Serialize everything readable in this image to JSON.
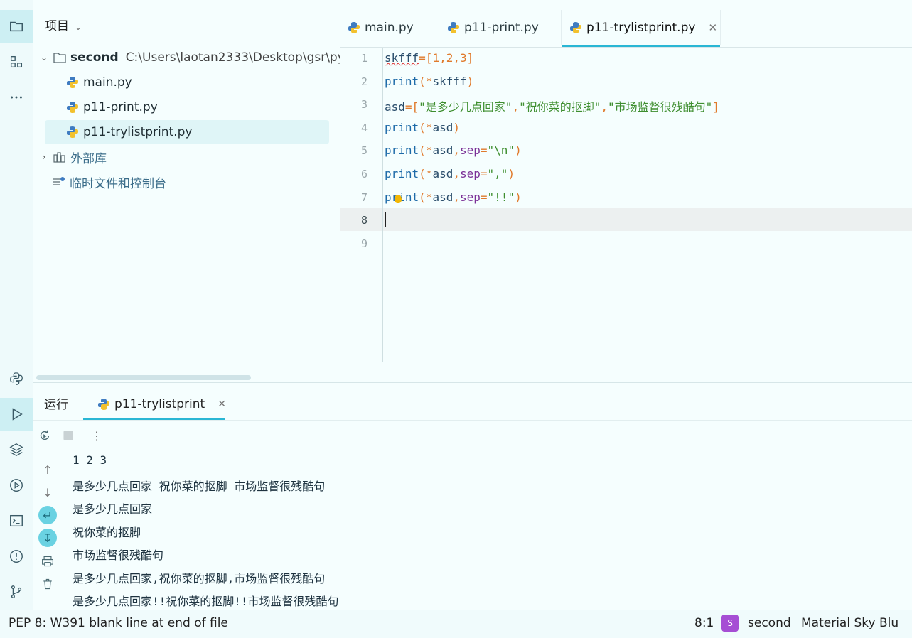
{
  "project_panel": {
    "title": "项目",
    "tree": {
      "root_name": "second",
      "root_path": "C:\\Users\\laotan2333\\Desktop\\gsr\\py",
      "files": [
        "main.py",
        "p11-print.py",
        "p11-trylistprint.py"
      ],
      "external_libs": "外部库",
      "scratches": "临时文件和控制台"
    }
  },
  "tabs": [
    {
      "label": "main.py"
    },
    {
      "label": "p11-print.py"
    },
    {
      "label": "p11-trylistprint.py"
    }
  ],
  "editor": {
    "line_numbers": [
      "1",
      "2",
      "3",
      "4",
      "5",
      "6",
      "7",
      "8",
      "9"
    ],
    "current_line": "8",
    "lines": [
      [
        {
          "t": "skfff",
          "c": "var wavy"
        },
        {
          "t": "=[",
          "c": "op"
        },
        {
          "t": "1",
          "c": "num"
        },
        {
          "t": ",",
          "c": "op"
        },
        {
          "t": "2",
          "c": "num"
        },
        {
          "t": ",",
          "c": "op"
        },
        {
          "t": "3",
          "c": "num"
        },
        {
          "t": "]",
          "c": "op"
        }
      ],
      [
        {
          "t": "print",
          "c": "fn"
        },
        {
          "t": "(*",
          "c": "op"
        },
        {
          "t": "skfff",
          "c": "var"
        },
        {
          "t": ")",
          "c": "op"
        }
      ],
      [
        {
          "t": "asd",
          "c": "var"
        },
        {
          "t": "=[",
          "c": "op"
        },
        {
          "t": "\"是多少几点回家\"",
          "c": "str"
        },
        {
          "t": ",",
          "c": "op"
        },
        {
          "t": "\"祝你菜的抠脚\"",
          "c": "str"
        },
        {
          "t": ",",
          "c": "op"
        },
        {
          "t": "\"市场监督很残酷句\"",
          "c": "str"
        },
        {
          "t": "]",
          "c": "op"
        }
      ],
      [
        {
          "t": "print",
          "c": "fn"
        },
        {
          "t": "(*",
          "c": "op"
        },
        {
          "t": "asd",
          "c": "var"
        },
        {
          "t": ")",
          "c": "op"
        }
      ],
      [
        {
          "t": "print",
          "c": "fn"
        },
        {
          "t": "(*",
          "c": "op"
        },
        {
          "t": "asd",
          "c": "var"
        },
        {
          "t": ",",
          "c": "op"
        },
        {
          "t": "sep",
          "c": "arg"
        },
        {
          "t": "=",
          "c": "op"
        },
        {
          "t": "\"\\n\"",
          "c": "str"
        },
        {
          "t": ")",
          "c": "op"
        }
      ],
      [
        {
          "t": "print",
          "c": "fn"
        },
        {
          "t": "(*",
          "c": "op"
        },
        {
          "t": "asd",
          "c": "var"
        },
        {
          "t": ",",
          "c": "op"
        },
        {
          "t": "sep",
          "c": "arg"
        },
        {
          "t": "=",
          "c": "op"
        },
        {
          "t": "\",\"",
          "c": "str"
        },
        {
          "t": ")",
          "c": "op"
        }
      ],
      [
        {
          "t": "print",
          "c": "fn"
        },
        {
          "t": "(*",
          "c": "op"
        },
        {
          "t": "asd",
          "c": "var"
        },
        {
          "t": ",",
          "c": "op"
        },
        {
          "t": "sep",
          "c": "arg"
        },
        {
          "t": "=",
          "c": "op"
        },
        {
          "t": "\"!!\"",
          "c": "str"
        },
        {
          "t": ")",
          "c": "op"
        }
      ],
      [],
      []
    ]
  },
  "run_panel": {
    "title": "运行",
    "tab_label": "p11-trylistprint",
    "output": [
      "1 2 3",
      "是多少几点回家 祝你菜的抠脚 市场监督很残酷句",
      "是多少几点回家",
      "祝你菜的抠脚",
      "市场监督很残酷句",
      "是多少几点回家,祝你菜的抠脚,市场监督很残酷句",
      "是多少几点回家!!祝你菜的抠脚!!市场监督很残酷句"
    ]
  },
  "status_bar": {
    "message": "PEP 8: W391 blank line at end of file",
    "position": "8:1",
    "project_badge": "S",
    "project": "second",
    "theme": "Material Sky Blu"
  },
  "colors": {
    "accent": "#29b6d4",
    "background": "#f5fefe",
    "badge": "#a64ed4"
  }
}
